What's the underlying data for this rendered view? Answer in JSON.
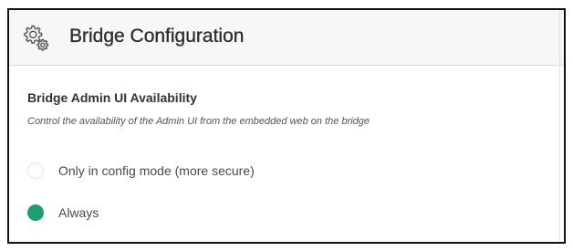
{
  "header": {
    "icon": "gears-icon",
    "title": "Bridge Configuration"
  },
  "section": {
    "title": "Bridge Admin UI Availability",
    "description": "Control the availability of the Admin UI from the embedded web on the bridge"
  },
  "options": [
    {
      "label": "Only in config mode (more secure)",
      "selected": false
    },
    {
      "label": "Always",
      "selected": true
    }
  ],
  "colors": {
    "accent": "#1e9e73",
    "header_bg": "#f7f7f7"
  }
}
